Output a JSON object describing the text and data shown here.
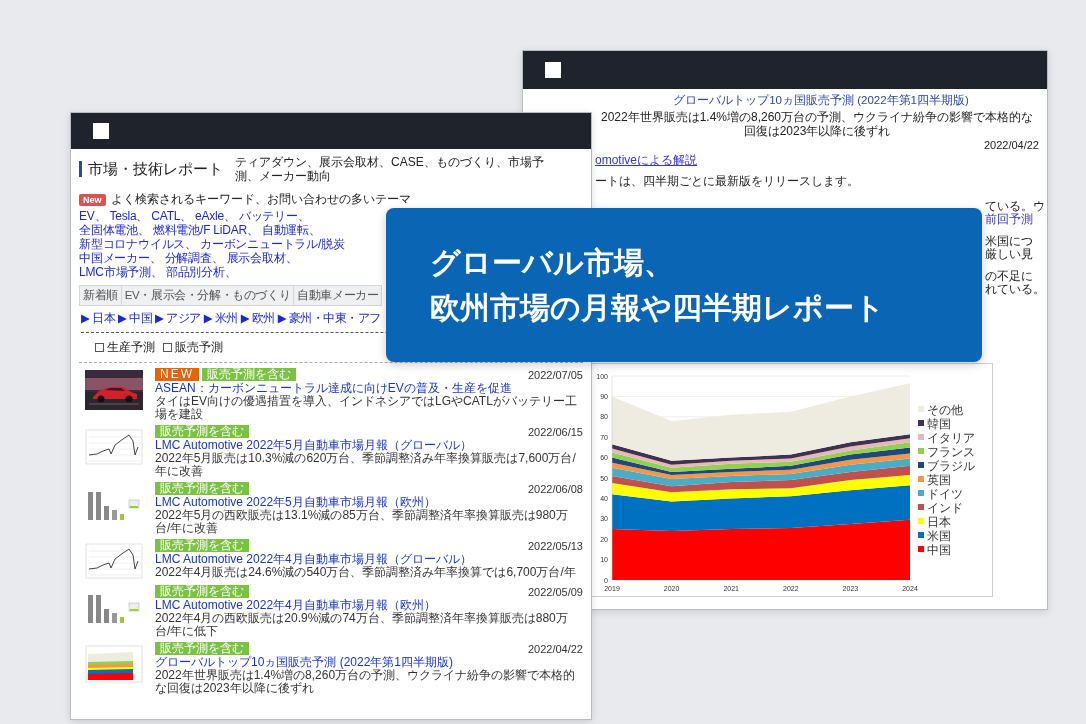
{
  "left_window": {
    "header": {
      "title": "市場・技術レポート",
      "topics": "ティアダウン、展示会取材、CASE、ものづくり、市場予測、メーカー動向"
    },
    "keywords": {
      "badge": "New",
      "heading": "よく検索されるキーワード、お問い合わせの多いテーマ",
      "lines": [
        [
          "EV、",
          "Tesla、",
          "CATL、",
          "eAxle、",
          "バッテリー、",
          "全固体電池、",
          "燃料電池/F"
        ],
        [
          "LiDAR、",
          "自動運転、",
          "新型コロナウイルス、",
          "カーボンニュートラル/脱炭"
        ],
        [
          "中国メーカー、",
          "分解調査、",
          "展示会取材、",
          "LMC市場予測、",
          "部品別分析、"
        ]
      ]
    },
    "tabs": [
      {
        "label": "新着順",
        "selected": false
      },
      {
        "label": "EV・展示会・分解・ものづくり",
        "selected": false
      },
      {
        "label": "自動車メーカー",
        "selected": false
      }
    ],
    "regions": [
      "▶ 日本",
      "▶ 中国",
      "▶ アジア",
      "▶ 米州",
      "▶ 欧州",
      "▶ 豪州・中東・アフ"
    ],
    "filters": [
      {
        "label": "生産予測",
        "checked": false
      },
      {
        "label": "販売予測",
        "checked": false
      }
    ],
    "articles": [
      {
        "tags": [
          {
            "label": "NEW",
            "kind": "new"
          },
          {
            "label": "販売予測を含む",
            "kind": "forecast"
          }
        ],
        "title": "ASEAN：カーボンニュートラル達成に向けEVの普及・生産を促進",
        "summary": "タイはEV向けの優遇措置を導入、インドネシアではLGやCATLがバッテリー工場を建設",
        "date": "2022/07/05"
      },
      {
        "kind": "line",
        "tags": [
          {
            "label": "販売予測を含む",
            "kind": "forecast"
          }
        ],
        "title": "LMC Automotive 2022年5月自動車市場月報（グローバル）",
        "summary": "2022年5月販売は10.3%減の620万台、季節調整済み年率換算販売は7,600万台/年に改善",
        "date": "2022/06/15"
      },
      {
        "kind": "bar",
        "tags": [
          {
            "label": "販売予測を含む",
            "kind": "forecast"
          }
        ],
        "title": "LMC Automotive 2022年5月自動車市場月報（欧州）",
        "summary": "2022年5月の西欧販売は13.1%減の85万台、季節調整済年率換算販売は980万台/年に改善",
        "date": "2022/06/08"
      },
      {
        "kind": "line",
        "tags": [
          {
            "label": "販売予測を含む",
            "kind": "forecast"
          }
        ],
        "title": "LMC Automotive 2022年4月自動車市場月報（グローバル）",
        "summary": "2022年4月販売は24.6%減の540万台、季節調整済み年率換算では6,700万台/年",
        "date": "2022/05/13"
      },
      {
        "kind": "bar",
        "tags": [
          {
            "label": "販売予測を含む",
            "kind": "forecast"
          }
        ],
        "title": "LMC Automotive 2022年4月自動車市場月報（欧州）",
        "summary": "2022年4月の西欧販売は20.9%減の74万台、季節調整済年率換算販売は880万台/年に低下",
        "date": "2022/05/09"
      },
      {
        "kind": "area",
        "tags": [
          {
            "label": "販売予測を含む",
            "kind": "forecast"
          }
        ],
        "title": "グローバルトップ10ヵ国販売予測 (2022年第1四半期版)",
        "summary": "2022年世界販売は1.4%増の8,260万台の予測、ウクライナ紛争の影響で本格的な回復は2023年以降に後ずれ",
        "date": "2022/04/22"
      }
    ]
  },
  "right_window": {
    "title": "グローバルトップ10ヵ国販売予測 (2022年第1四半期版)",
    "subtitle": "2022年世界販売は1.4%増の8,260万台の予測、ウクライナ紛争の影響で本格的な回復は2023年以降に後ずれ",
    "date": "2022/04/22",
    "link": "omotiveによる解説",
    "note": "ートは、四半期ごとに最新版をリリースします。",
    "fragments": [
      {
        "text": "ている。ウ",
        "kind": "text"
      },
      {
        "text": "前回予測",
        "kind": "link"
      },
      {
        "text": "米国につ",
        "kind": "text"
      },
      {
        "text": "厳しい見",
        "kind": "text"
      },
      {
        "text": "の不足に",
        "kind": "text"
      },
      {
        "text": "れている。",
        "kind": "text"
      }
    ],
    "chart_data": {
      "type": "area",
      "stacked": true,
      "legend": true,
      "x": [
        "2019",
        "2020",
        "2021",
        "2022",
        "2023",
        "2024"
      ],
      "ylim": [
        0,
        100
      ],
      "yticks": [
        0,
        10,
        20,
        30,
        40,
        50,
        60,
        70,
        80,
        90,
        100
      ],
      "series": [
        {
          "name": "中国",
          "color": "#ff0000",
          "values": [
            25,
            24,
            25,
            25.5,
            27.5,
            29.5
          ]
        },
        {
          "name": "米国",
          "color": "#0070c0",
          "values": [
            17,
            14.5,
            15,
            15.5,
            16.5,
            17
          ]
        },
        {
          "name": "日本",
          "color": "#ffff00",
          "values": [
            5.5,
            4.5,
            4.5,
            4,
            5,
            5
          ]
        },
        {
          "name": "インド",
          "color": "#c0504d",
          "values": [
            3.5,
            3,
            3.5,
            4,
            4,
            4.5
          ]
        },
        {
          "name": "ドイツ",
          "color": "#4bacc6",
          "values": [
            4,
            3.5,
            3,
            3,
            3.5,
            3.5
          ]
        },
        {
          "name": "英国",
          "color": "#f79646",
          "values": [
            2.5,
            2,
            2,
            2,
            2.5,
            2.5
          ]
        },
        {
          "name": "ブラジル",
          "color": "#1f497d",
          "values": [
            2.5,
            1.5,
            1.5,
            2,
            2.5,
            3
          ]
        },
        {
          "name": "フランス",
          "color": "#92d050",
          "values": [
            2.5,
            2,
            2.5,
            2,
            2,
            2.5
          ]
        },
        {
          "name": "イタリア",
          "color": "#e6b9b8",
          "values": [
            2,
            1.5,
            1.5,
            1.5,
            2,
            2
          ]
        },
        {
          "name": "韓国",
          "color": "#403151",
          "values": [
            2,
            2,
            1.5,
            2,
            2,
            2
          ]
        },
        {
          "name": "その他",
          "color": "#eeece1",
          "values": [
            23.5,
            19.5,
            21,
            21,
            22.5,
            25
          ]
        }
      ]
    }
  },
  "banner": {
    "lines": [
      "グローバル市場、",
      "欧州市場の月報や四半期レポート"
    ]
  }
}
